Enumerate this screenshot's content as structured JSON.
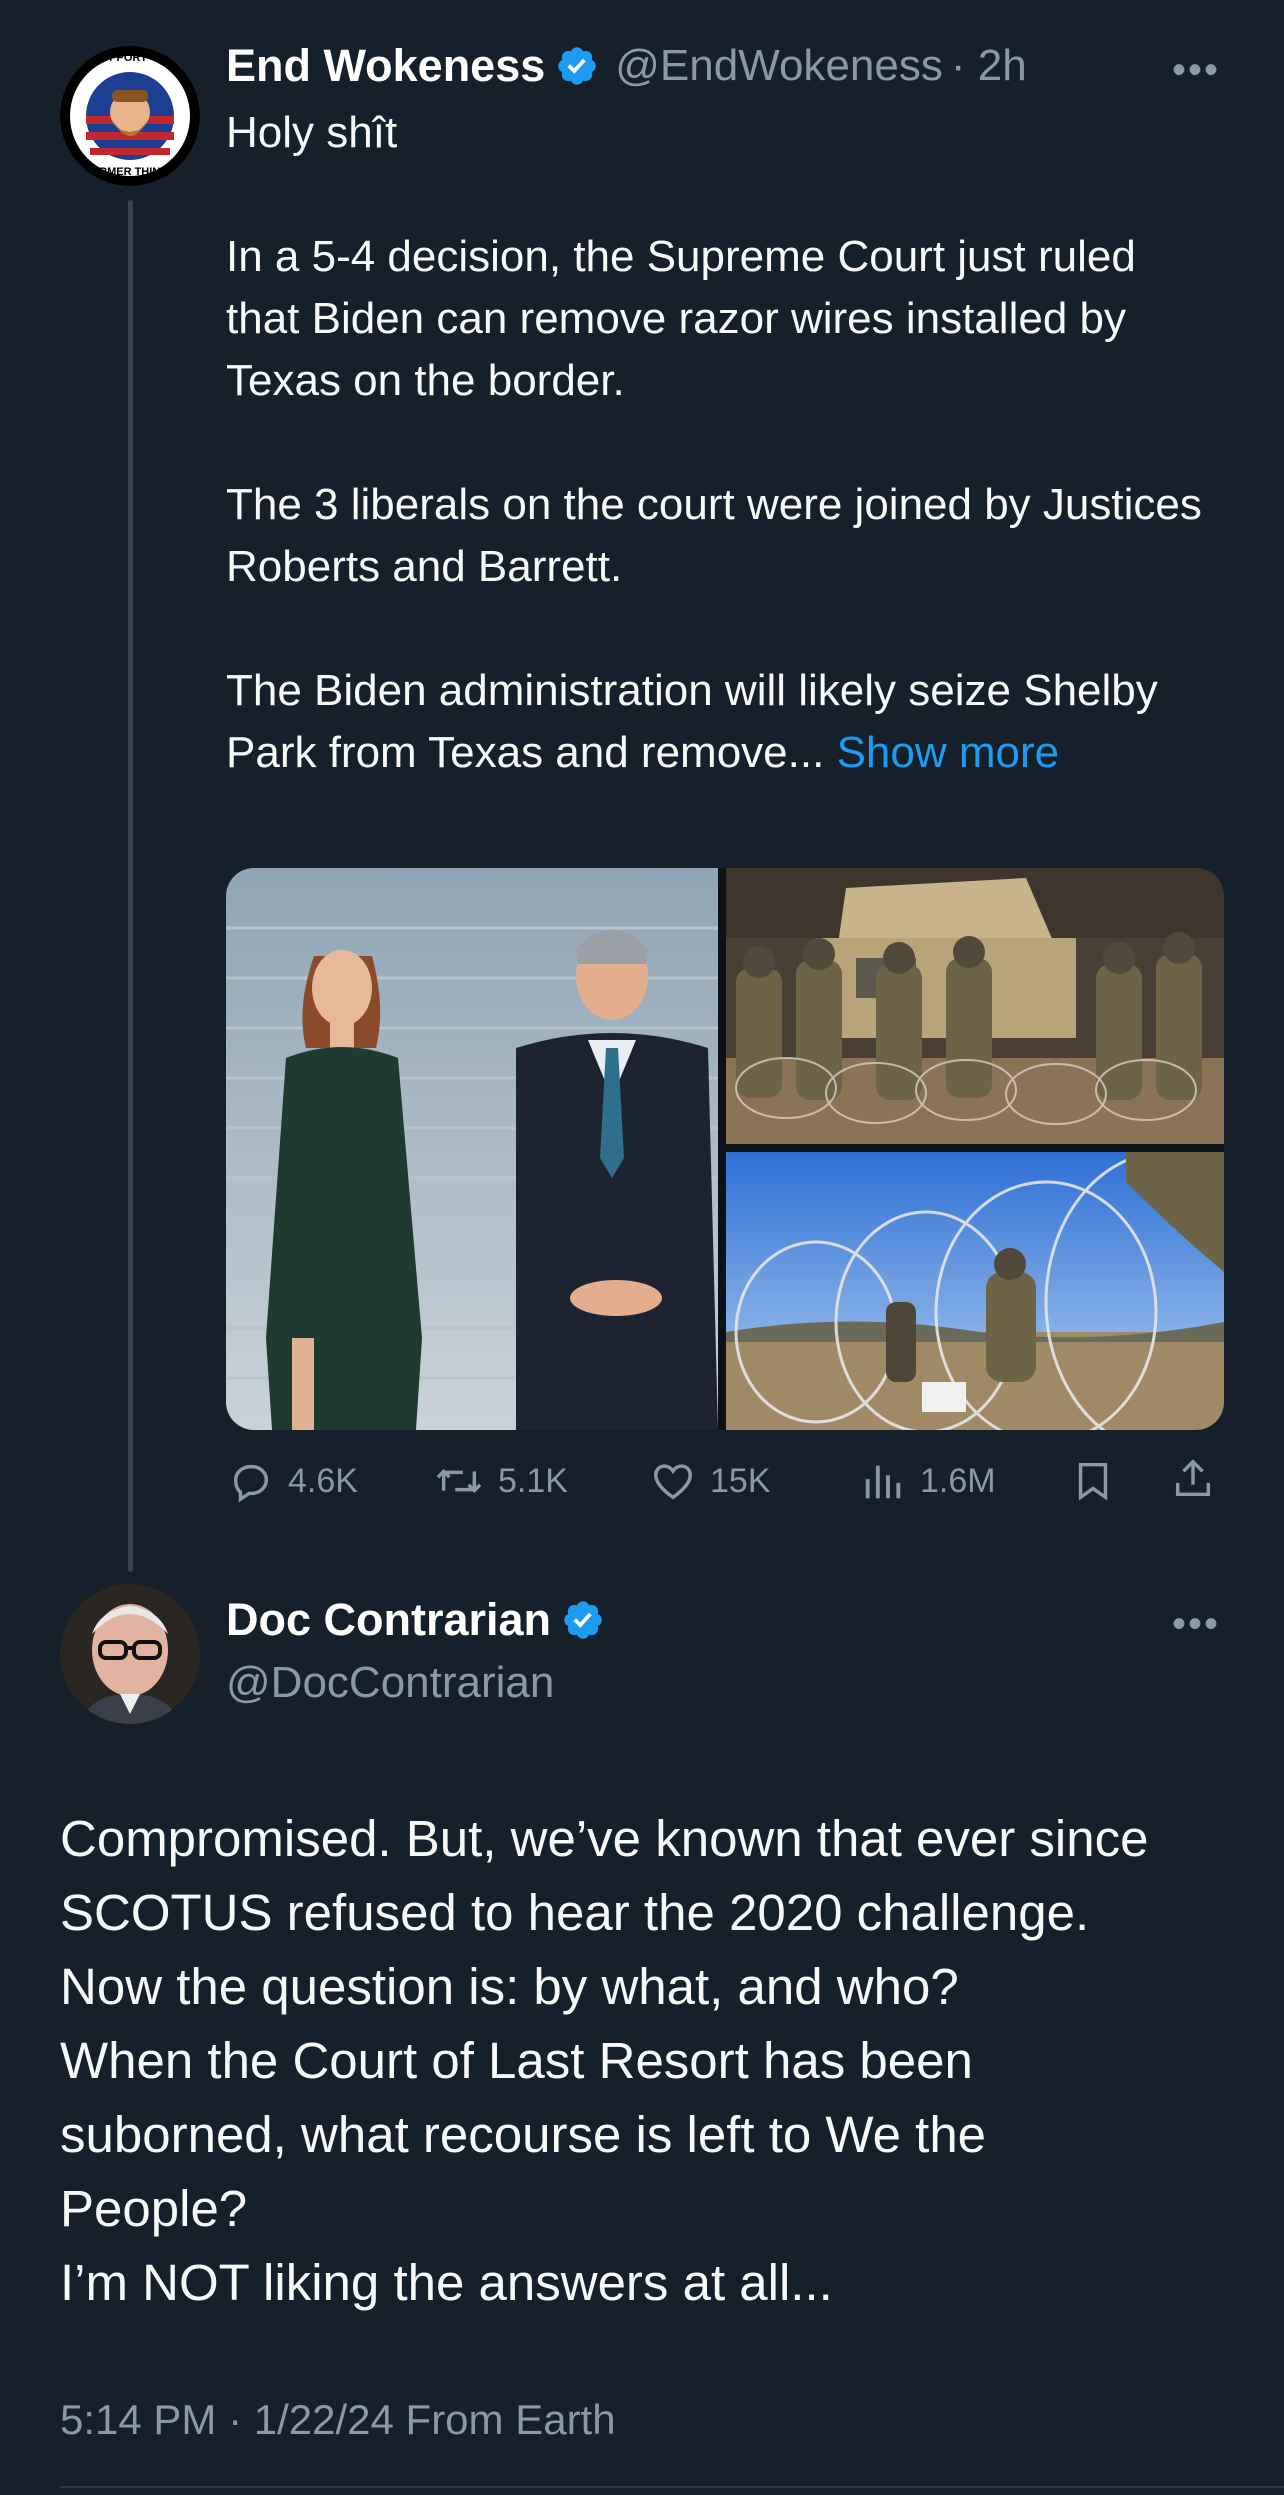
{
  "tweet": {
    "author_name": "End Wokeness",
    "handle": "@EndWokeness",
    "time": "· 2h",
    "more": "•••",
    "avatar_badge_top": "I SUPPORT THE",
    "avatar_badge_bottom": "FORMER THINGS",
    "paragraphs": [
      "Holy shît",
      "In a 5-4 decision, the Supreme Court just ruled that Biden can remove razor wires installed by Texas on the border.",
      "The 3 liberals on the court were joined by Justices Roberts and Barrett.",
      "The Biden administration will likely seize Shelby Park from Texas and remove..."
    ],
    "show_more": "Show more",
    "actions": {
      "replies": "4.6K",
      "retweets": "5.1K",
      "likes": "15K",
      "views": "1.6M"
    }
  },
  "reply": {
    "author_name": "Doc Contrarian",
    "handle": "@DocContrarian",
    "more": "•••",
    "lines": [
      "Compromised. But, we’ve known that ever since",
      "SCOTUS refused to hear the 2020 challenge.",
      "Now the question is: by what, and who?",
      "When the Court of Last Resort has been",
      "suborned, what recourse is left to We the",
      "People?",
      "I’m NOT liking the answers at all..."
    ],
    "timestamp": "5:14 PM · 1/22/24 From Earth"
  },
  "icons": {
    "verified": "verified-badge-icon",
    "reply": "reply-icon",
    "retweet": "retweet-icon",
    "like": "heart-icon",
    "views": "views-bar-icon",
    "bookmark": "bookmark-icon",
    "share": "share-icon"
  },
  "colors": {
    "background": "#15202b",
    "accent": "#1d9bf0",
    "secondary_text": "#8b98a5"
  }
}
